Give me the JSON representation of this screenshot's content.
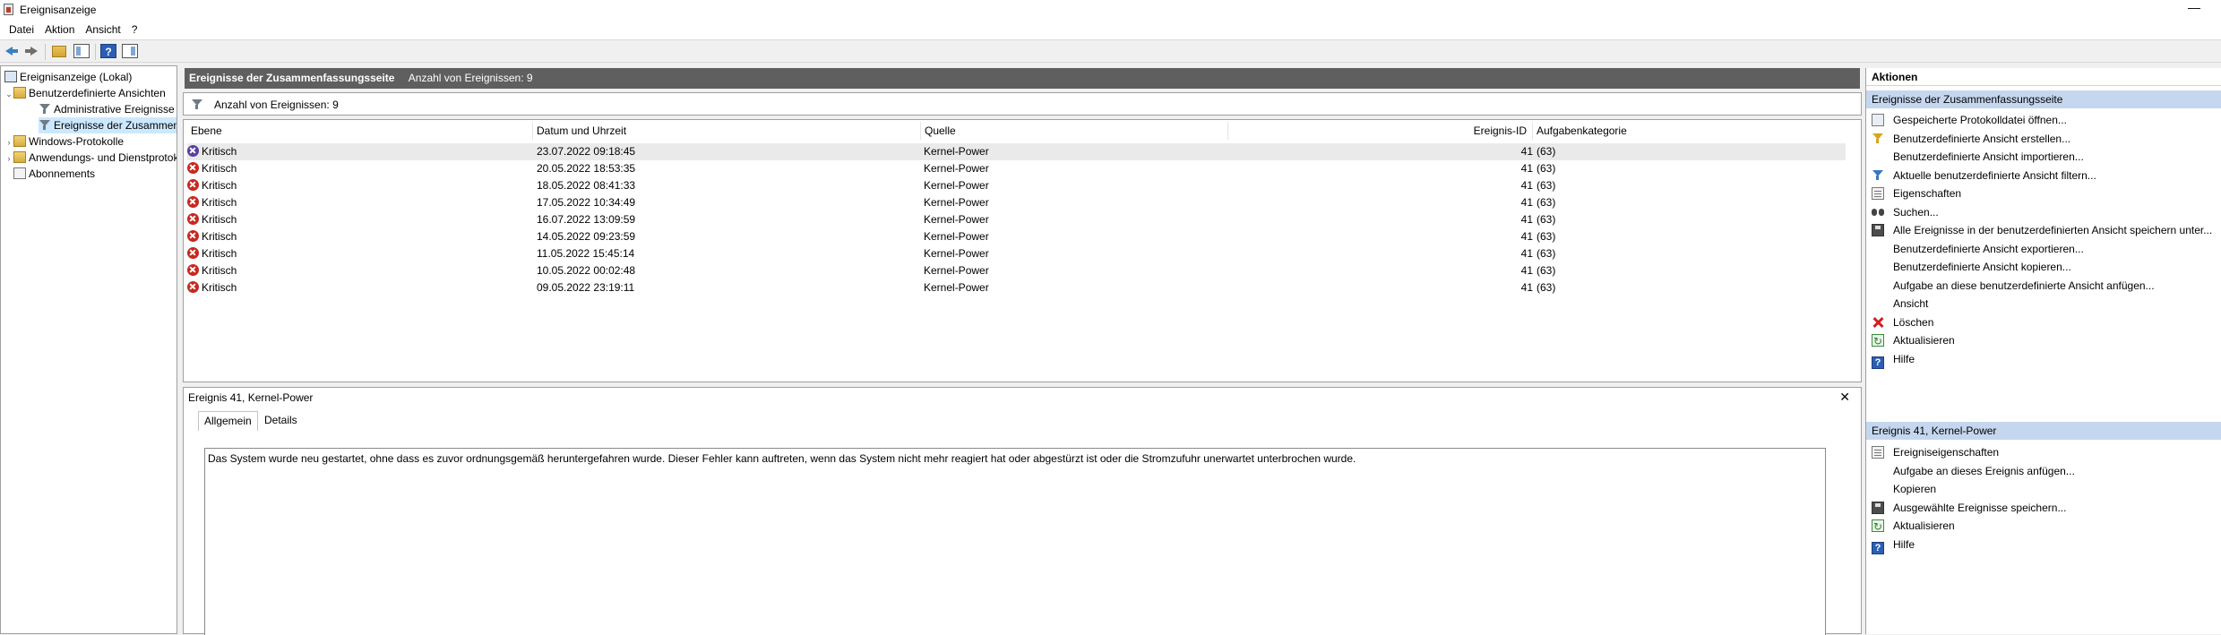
{
  "window": {
    "title": "Ereignisanzeige",
    "minimize_glyph": "—"
  },
  "menu": [
    "Datei",
    "Aktion",
    "Ansicht",
    "?"
  ],
  "toolbar": {
    "icons": [
      "back-arrow-icon",
      "forward-arrow-icon",
      "up-folder-icon",
      "show-hide-tree-icon",
      "help-icon",
      "show-hide-action-pane-icon"
    ]
  },
  "tree": {
    "root": "Ereignisanzeige (Lokal)",
    "custom_views": "Benutzerdefinierte Ansichten",
    "admin_events": "Administrative Ereignisse",
    "summary_events": "Ereignisse der Zusammenfassungsseite",
    "windows_logs": "Windows-Protokolle",
    "app_service_logs": "Anwendungs- und Dienstprotokolle",
    "subscriptions": "Abonnements"
  },
  "events_panel": {
    "title": "Ereignisse der Zusammenfassungsseite",
    "count_label": "Anzahl von Ereignissen: 9",
    "filter_label": "Anzahl von Ereignissen: 9",
    "columns": {
      "level": "Ebene",
      "datetime": "Datum und Uhrzeit",
      "source": "Quelle",
      "event_id": "Ereignis-ID",
      "task_category": "Aufgabenkategorie"
    },
    "rows": [
      {
        "level": "Kritisch",
        "datetime": "23.07.2022 09:18:45",
        "source": "Kernel-Power",
        "event_id": "41",
        "task_category": "(63)"
      },
      {
        "level": "Kritisch",
        "datetime": "20.05.2022 18:53:35",
        "source": "Kernel-Power",
        "event_id": "41",
        "task_category": "(63)"
      },
      {
        "level": "Kritisch",
        "datetime": "18.05.2022 08:41:33",
        "source": "Kernel-Power",
        "event_id": "41",
        "task_category": "(63)"
      },
      {
        "level": "Kritisch",
        "datetime": "17.05.2022 10:34:49",
        "source": "Kernel-Power",
        "event_id": "41",
        "task_category": "(63)"
      },
      {
        "level": "Kritisch",
        "datetime": "16.07.2022 13:09:59",
        "source": "Kernel-Power",
        "event_id": "41",
        "task_category": "(63)"
      },
      {
        "level": "Kritisch",
        "datetime": "14.05.2022 09:23:59",
        "source": "Kernel-Power",
        "event_id": "41",
        "task_category": "(63)"
      },
      {
        "level": "Kritisch",
        "datetime": "11.05.2022 15:45:14",
        "source": "Kernel-Power",
        "event_id": "41",
        "task_category": "(63)"
      },
      {
        "level": "Kritisch",
        "datetime": "10.05.2022 00:02:48",
        "source": "Kernel-Power",
        "event_id": "41",
        "task_category": "(63)"
      },
      {
        "level": "Kritisch",
        "datetime": "09.05.2022 23:19:11",
        "source": "Kernel-Power",
        "event_id": "41",
        "task_category": "(63)"
      }
    ]
  },
  "detail": {
    "title": "Ereignis 41, Kernel-Power",
    "close_glyph": "✕",
    "tabs": [
      "Allgemein",
      "Details"
    ],
    "description": "Das System wurde neu gestartet, ohne dass es zuvor ordnungsgemäß heruntergefahren wurde. Dieser Fehler kann auftreten, wenn das System nicht mehr reagiert hat oder abgestürzt ist oder die Stromzufuhr unerwartet unterbrochen wurde."
  },
  "actions": {
    "header": "Aktionen",
    "section1": "Ereignisse der Zusammenfassungsseite",
    "items1": [
      {
        "label": "Gespeicherte Protokolldatei öffnen...",
        "icon": "open-log-icon"
      },
      {
        "label": "Benutzerdefinierte Ansicht erstellen...",
        "icon": "create-view-filter-icon"
      },
      {
        "label": "Benutzerdefinierte Ansicht importieren...",
        "icon": ""
      },
      {
        "label": "Aktuelle benutzerdefinierte Ansicht filtern...",
        "icon": "filter-icon"
      },
      {
        "label": "Eigenschaften",
        "icon": "properties-icon"
      },
      {
        "label": "Suchen...",
        "icon": "binoculars-icon"
      },
      {
        "label": "Alle Ereignisse in der benutzerdefinierten Ansicht speichern unter...",
        "icon": "save-icon"
      },
      {
        "label": "Benutzerdefinierte Ansicht exportieren...",
        "icon": ""
      },
      {
        "label": "Benutzerdefinierte Ansicht kopieren...",
        "icon": ""
      },
      {
        "label": "Aufgabe an diese benutzerdefinierte Ansicht anfügen...",
        "icon": ""
      },
      {
        "label": "Ansicht",
        "icon": ""
      },
      {
        "label": "Löschen",
        "icon": "delete-icon"
      },
      {
        "label": "Aktualisieren",
        "icon": "refresh-icon"
      },
      {
        "label": "Hilfe",
        "icon": "help-icon"
      }
    ],
    "section2": "Ereignis 41, Kernel-Power",
    "items2": [
      {
        "label": "Ereigniseigenschaften",
        "icon": "event-properties-icon"
      },
      {
        "label": "Aufgabe an dieses Ereignis anfügen...",
        "icon": ""
      },
      {
        "label": "Kopieren",
        "icon": "copy-icon"
      },
      {
        "label": "Ausgewählte Ereignisse speichern...",
        "icon": "save-icon"
      },
      {
        "label": "Aktualisieren",
        "icon": "refresh-icon"
      },
      {
        "label": "Hilfe",
        "icon": "help-icon"
      }
    ]
  },
  "colors": {
    "critical": "#c8281e",
    "section_header": "#c5d7ef",
    "panel_header": "#5f5f5f",
    "selected_tree": "#cce8ff"
  }
}
